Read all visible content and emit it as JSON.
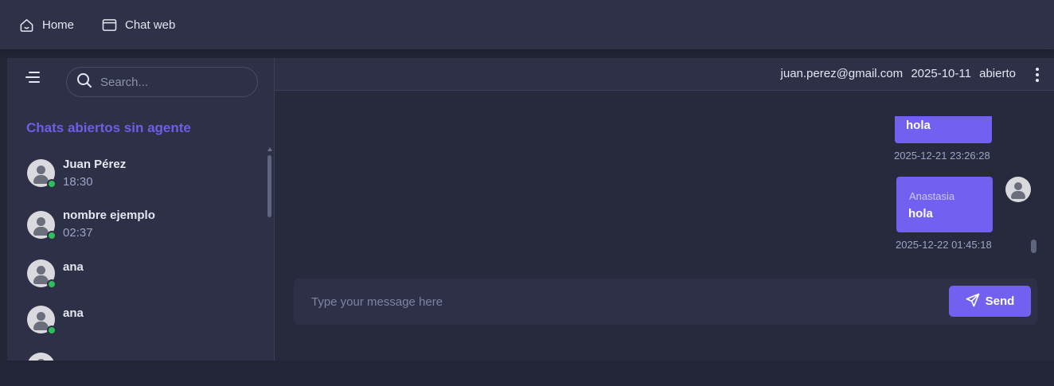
{
  "topbar": {
    "home_label": "Home",
    "chatweb_label": "Chat web"
  },
  "sidebar": {
    "search_placeholder": "Search...",
    "section_title": "Chats abiertos sin agente",
    "chats": [
      {
        "name": "Juan Pérez",
        "time": "18:30",
        "online": true
      },
      {
        "name": "nombre ejemplo",
        "time": "02:37",
        "online": true
      },
      {
        "name": "ana",
        "time": "",
        "online": true
      },
      {
        "name": "ana",
        "time": "",
        "online": true
      }
    ]
  },
  "chat_header": {
    "email": "juan.perez@gmail.com",
    "date": "2025-10-11",
    "status": "abierto"
  },
  "messages": [
    {
      "sender": "",
      "text": "hola",
      "timestamp": "2025-12-21 23:26:28"
    },
    {
      "sender": "Anastasia",
      "text": "hola",
      "timestamp": "2025-12-22 01:45:18"
    }
  ],
  "composer": {
    "placeholder": "Type your message here",
    "send_label": "Send"
  },
  "colors": {
    "accent": "#7260f0",
    "section_title": "#6f5de6",
    "online": "#2fbf5a",
    "background": "#222536",
    "panel": "#2d3047"
  }
}
